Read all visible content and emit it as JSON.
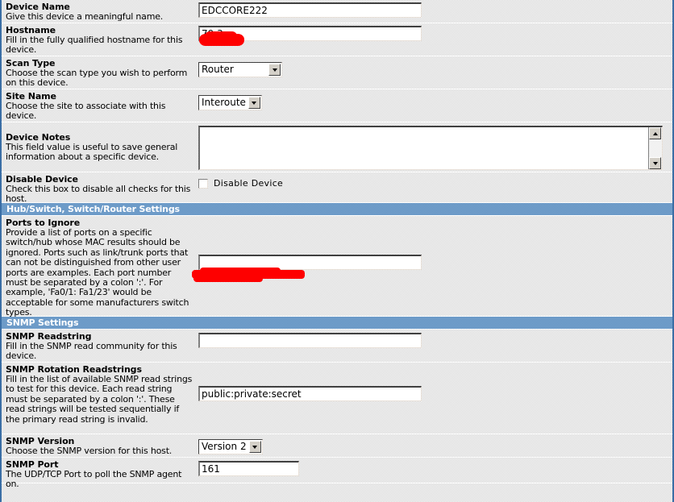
{
  "form": {
    "rows": [
      {
        "id": "device-name",
        "title": "Device Name",
        "help": "Give this device a meaningful name.",
        "control": "text",
        "value": "EDCCORE222",
        "placeholder": ""
      },
      {
        "id": "hostname",
        "title": "Hostname",
        "help": "Fill in the fully qualified hostname for this device.",
        "control": "text",
        "value": "79.3",
        "placeholder": "",
        "redacted": true
      },
      {
        "id": "scan-type",
        "title": "Scan Type",
        "help": "Choose the scan type you wish to perform on this device.",
        "control": "select",
        "value": "Router"
      },
      {
        "id": "site-name",
        "title": "Site Name",
        "help": "Choose the site to associate with this device.",
        "control": "select",
        "value": "Interoute"
      },
      {
        "id": "device-notes",
        "title": "Device Notes",
        "help": "This field value is useful to save general information about a specific device.",
        "control": "textarea",
        "value": ""
      },
      {
        "id": "disable-device",
        "title": "Disable Device",
        "help": "Check this box to disable all checks for this host.",
        "control": "checkbox",
        "checkbox_label": "Disable Device",
        "checked": false
      }
    ],
    "section_hub": {
      "title": "Hub/Switch, Switch/Router Settings",
      "rows": [
        {
          "id": "ports-to-ignore",
          "title": "Ports to Ignore",
          "help": "Provide a list of ports on a specific switch/hub whose MAC results should be ignored. Ports such as link/trunk ports that can not be distinguished from other user ports are examples. Each port number must be separated by a colon ':'. For example, 'Fa0/1: Fa1/23' would be acceptable for some manufacturers switch types.",
          "control": "text",
          "value": "",
          "redacted": true
        }
      ]
    },
    "section_snmp": {
      "title": "SNMP Settings",
      "rows": [
        {
          "id": "snmp-readstring",
          "title": "SNMP Readstring",
          "help": "Fill in the SNMP read community for this device.",
          "control": "text",
          "value": ""
        },
        {
          "id": "snmp-rotation-readstrings",
          "title": "SNMP Rotation Readstrings",
          "help": "Fill in the list of available SNMP read strings to test for this device. Each read string must be separated by a colon ':'. These read strings will be tested sequentially if the primary read string is invalid.",
          "control": "text",
          "value": "public:private:secret"
        },
        {
          "id": "snmp-version",
          "title": "SNMP Version",
          "help": "Choose the SNMP version for this host.",
          "control": "select",
          "value": "Version 2"
        },
        {
          "id": "snmp-port",
          "title": "SNMP Port",
          "help": "The UDP/TCP Port to poll the SNMP agent on.",
          "control": "text",
          "value": "161"
        }
      ]
    }
  },
  "colors": {
    "section_bar": "#5f8fc0",
    "page_border": "#3a6ea5",
    "redaction": "#fe0000",
    "text": "#000000"
  }
}
